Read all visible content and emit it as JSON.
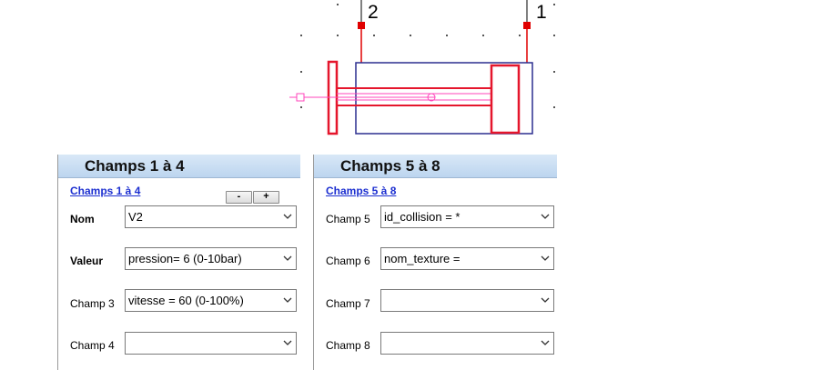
{
  "diagram": {
    "port_labels": [
      "2",
      "1"
    ]
  },
  "panels": {
    "left": {
      "title": "Champs 1 à 4",
      "section_link": "Champs 1 à 4",
      "buttons": {
        "minus": "-",
        "plus": "+"
      },
      "fields": [
        {
          "label": "Nom",
          "value": "V2"
        },
        {
          "label": "Valeur",
          "value": "pression= 6 (0-10bar)"
        },
        {
          "label": "Champ 3",
          "value": "vitesse = 60 (0-100%)"
        },
        {
          "label": "Champ 4",
          "value": ""
        }
      ]
    },
    "right": {
      "title": "Champs 5 à 8",
      "section_link": "Champs 5 à 8",
      "fields": [
        {
          "label": "Champ 5",
          "value": "id_collision = *"
        },
        {
          "label": "Champ 6",
          "value": "nom_texture ="
        },
        {
          "label": "Champ 7",
          "value": ""
        },
        {
          "label": "Champ 8",
          "value": ""
        }
      ]
    }
  },
  "colors": {
    "cylinder_outline": "#2b2e8f",
    "piston": "#e5162c",
    "rod": "#ff44bb",
    "port": "#e00000",
    "link": "#1c2fd0",
    "header_gradient_top": "#d9e8f7",
    "header_gradient_bottom": "#bcd5ef"
  }
}
